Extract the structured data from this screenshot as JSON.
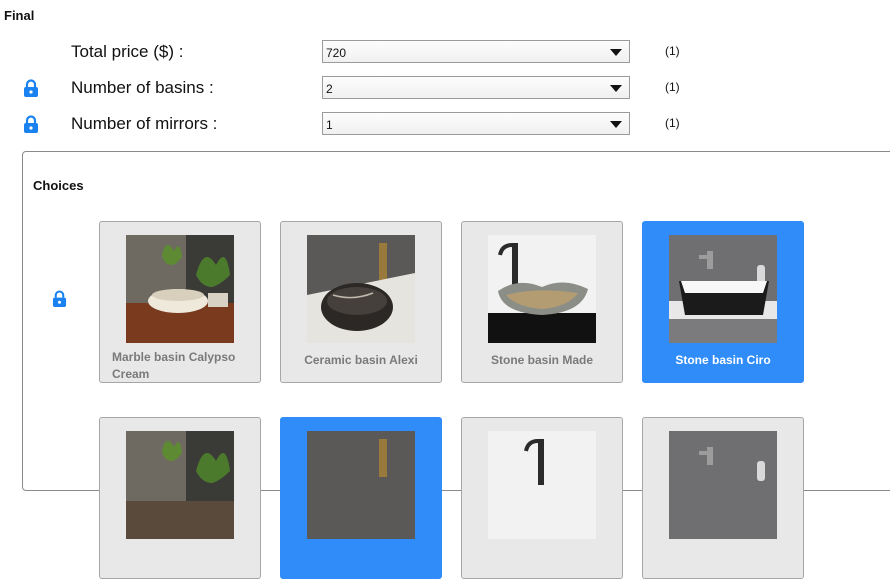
{
  "section": {
    "title": "Final"
  },
  "rows": [
    {
      "label": "Total price ($) :",
      "value": "720",
      "count": "(1)",
      "locked": false
    },
    {
      "label": "Number of basins :",
      "value": "2",
      "count": "(1)",
      "locked": true
    },
    {
      "label": "Number of mirrors :",
      "value": "1",
      "count": "(1)",
      "locked": true
    }
  ],
  "choices": {
    "title": "Choices",
    "items": [
      {
        "caption": "Marble basin Calypso Cream",
        "selected": false
      },
      {
        "caption": "Ceramic basin Alexi",
        "selected": false
      },
      {
        "caption": "Stone basin Made",
        "selected": false
      },
      {
        "caption": "Stone basin Ciro",
        "selected": true
      }
    ],
    "second_row_selected": [
      false,
      true,
      false,
      false
    ]
  },
  "icons": {
    "lock": "lock-icon",
    "dropdown": "chevron-down-icon"
  },
  "colors": {
    "accent": "#2f8cf8",
    "card_bg": "#e8e8e8",
    "caption": "#7a7a7a"
  }
}
